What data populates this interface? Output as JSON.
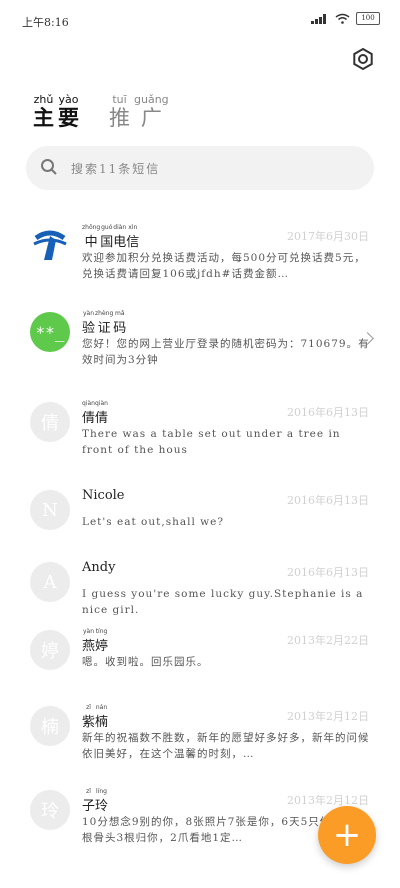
{
  "status_bar": {
    "time": "上午8:16",
    "battery": "100"
  },
  "tabs": [
    {
      "pinyin": [
        "zhǔ",
        "yào"
      ],
      "chars": [
        "主",
        "要"
      ]
    },
    {
      "pinyin": [
        "tuī",
        "guǎng"
      ],
      "chars": [
        "推",
        "广"
      ]
    }
  ],
  "search": {
    "placeholder": "搜索11条短信"
  },
  "messages": [
    {
      "avatar": "telecom-logo",
      "name": "中国电信",
      "date": "2017年6月30日",
      "preview": "欢迎参加积分兑换话费活动，每500分可兑换话费5元，兑换话费请回复106或jfdh#话费金额…"
    },
    {
      "avatar": "**_",
      "name": "验证码",
      "date": "",
      "preview": "您好！您的网上营业厅登录的随机密码为：710679。有效时间为3分钟"
    },
    {
      "avatar": "倩",
      "name": "倩倩",
      "date": "2016年6月13日",
      "preview": "There was a table set out under a tree in front of the hous"
    },
    {
      "avatar": "N",
      "name": "Nicole",
      "date": "2016年6月13日",
      "preview": "Let's eat out,shall we?"
    },
    {
      "avatar": "A",
      "name": "Andy",
      "date": "2016年6月13日",
      "preview": "I guess you're some lucky guy.Stephanie is a nice girl."
    },
    {
      "avatar": "婷",
      "name": "燕婷",
      "date": "2013年2月22日",
      "preview": "嗯。收到啦。回乐园乐。"
    },
    {
      "avatar": "楠",
      "name": "紫楠",
      "date": "2013年2月12日",
      "preview": "新年的祝福数不胜数，新年的愿望好多好多，新年的问候依旧美好，在这个温馨的时刻，…"
    },
    {
      "avatar": "玲",
      "name": "子玲",
      "date": "2013年2月12日",
      "preview": "10分想念9别的你，8张照片7张是你，6天5只像你，4根骨头3根归你，2爪看地1定…"
    }
  ],
  "name_pinyin": {
    "0": [
      "zhōng",
      "guó",
      "diàn",
      "xìn"
    ],
    "1": [
      "yàn",
      "zhèng",
      "mǎ"
    ],
    "2": [
      "qiàn",
      "qiàn"
    ],
    "5": [
      "yàn",
      "tíng"
    ],
    "6": [
      "zǐ",
      "nán"
    ],
    "7": [
      "zǐ",
      "líng"
    ]
  },
  "fab": {
    "label": "+"
  },
  "colors": {
    "accent": "#fb9c27",
    "verify_avatar": "#5ec94a",
    "telecom_blue": "#1660b8"
  }
}
